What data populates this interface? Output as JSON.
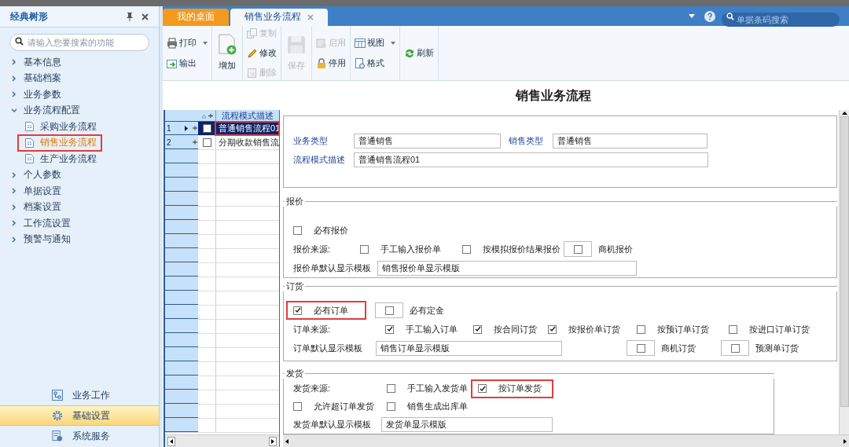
{
  "sidebar": {
    "title": "经典树形",
    "search": {
      "placeholder": "请输入您要搜索的功能"
    },
    "tree": [
      {
        "label": "基本信息",
        "expanded": false
      },
      {
        "label": "基础档案",
        "expanded": false
      },
      {
        "label": "业务参数",
        "expanded": false
      },
      {
        "label": "业务流程配置",
        "expanded": true,
        "children": [
          {
            "label": "采购业务流程",
            "selected": false,
            "highlighted": false
          },
          {
            "label": "销售业务流程",
            "selected": true,
            "highlighted": true
          },
          {
            "label": "生产业务流程",
            "selected": false,
            "highlighted": false
          }
        ]
      },
      {
        "label": "个人参数",
        "expanded": false
      },
      {
        "label": "单据设置",
        "expanded": false
      },
      {
        "label": "档案设置",
        "expanded": false
      },
      {
        "label": "工作流设置",
        "expanded": false
      },
      {
        "label": "预警与通知",
        "expanded": false
      }
    ],
    "nav": [
      {
        "label": "业务工作",
        "selected": false
      },
      {
        "label": "基础设置",
        "selected": true
      },
      {
        "label": "系统服务",
        "selected": false
      }
    ]
  },
  "tabs": [
    {
      "label": "我的桌面",
      "selected": false
    },
    {
      "label": "销售业务流程",
      "selected": true
    }
  ],
  "global_search": {
    "placeholder": "单据条码搜索"
  },
  "toolbar": [
    [
      {
        "label": "打印",
        "dropdown": true,
        "disabled": false,
        "kind": "small"
      },
      {
        "label": "输出",
        "dropdown": false,
        "disabled": false,
        "kind": "small"
      }
    ],
    [
      {
        "label": "增加",
        "dropdown": false,
        "disabled": false,
        "kind": "large"
      }
    ],
    [
      {
        "label": "复制",
        "dropdown": false,
        "disabled": true,
        "kind": "small"
      },
      {
        "label": "修改",
        "dropdown": false,
        "disabled": false,
        "kind": "small"
      },
      {
        "label": "删除",
        "dropdown": false,
        "disabled": true,
        "kind": "small"
      }
    ],
    [
      {
        "label": "保存",
        "dropdown": false,
        "disabled": true,
        "kind": "large"
      }
    ],
    [
      {
        "label": "启用",
        "dropdown": false,
        "disabled": true,
        "kind": "small"
      },
      {
        "label": "停用",
        "dropdown": false,
        "disabled": false,
        "kind": "small"
      }
    ],
    [
      {
        "label": "视图",
        "dropdown": true,
        "disabled": false,
        "kind": "small"
      },
      {
        "label": "格式",
        "dropdown": false,
        "disabled": false,
        "kind": "small"
      }
    ],
    [
      {
        "label": "刷新",
        "dropdown": false,
        "disabled": false,
        "kind": "small"
      }
    ]
  ],
  "page_title": "销售业务流程",
  "grid": {
    "column": "流程模式描述",
    "rows": [
      {
        "number": "1",
        "description": "普通销售流程01",
        "selected": true,
        "checked": false,
        "highlighted": true
      },
      {
        "number": "2",
        "description": "分期收款销售流",
        "selected": false,
        "checked": false,
        "highlighted": false
      }
    ]
  },
  "form": {
    "sections": [
      {
        "rows": [
          [
            {
              "kind": "field-label",
              "text": "业务类型"
            },
            {
              "kind": "field",
              "value": "普通销售"
            },
            {
              "kind": "field-label",
              "text": "销售类型"
            },
            {
              "kind": "field",
              "value": "普通销售"
            }
          ],
          [
            {
              "kind": "field-label",
              "text": "流程模式描述"
            },
            {
              "kind": "field",
              "value": "普通销售流程01"
            }
          ]
        ]
      },
      {
        "title": "报价",
        "rows": [
          [
            {
              "kind": "checkbox",
              "text": "必有报价",
              "checked": false,
              "highlighted": false
            }
          ],
          [
            {
              "kind": "label",
              "text": "报价来源:"
            },
            {
              "kind": "checkbox",
              "text": "手工输入报价单",
              "checked": false,
              "highlighted": false
            },
            {
              "kind": "checkbox",
              "text": "按模拟报价结果报价",
              "checked": false,
              "highlighted": false
            },
            {
              "kind": "boxed-checkbox",
              "text": "商机报价",
              "checked": false,
              "highlighted": false
            }
          ],
          [
            {
              "kind": "label",
              "text": "报价单默认显示模板"
            },
            {
              "kind": "field",
              "value": "销售报价单显示模版"
            }
          ]
        ]
      },
      {
        "title": "订货",
        "rows": [
          [
            {
              "kind": "checkbox",
              "text": "必有订单",
              "checked": true,
              "highlighted": true
            },
            {
              "kind": "boxed-checkbox",
              "text": "必有定金",
              "checked": false,
              "highlighted": false
            }
          ],
          [
            {
              "kind": "label",
              "text": "订单来源:"
            },
            {
              "kind": "checkbox",
              "text": "手工输入订单",
              "checked": true,
              "highlighted": false
            },
            {
              "kind": "checkbox",
              "text": "按合同订货",
              "checked": true,
              "highlighted": false
            },
            {
              "kind": "checkbox",
              "text": "按报价单订货",
              "checked": true,
              "highlighted": false
            },
            {
              "kind": "checkbox",
              "text": "按预订单订货",
              "checked": false,
              "highlighted": false
            },
            {
              "kind": "checkbox",
              "text": "按进口订单订货",
              "checked": false,
              "highlighted": false
            }
          ],
          [
            {
              "kind": "label",
              "text": "订单默认显示模板"
            },
            {
              "kind": "field",
              "value": "销售订单显示模版"
            },
            "",
            "",
            {
              "kind": "boxed-checkbox",
              "text": "商机订货",
              "checked": false,
              "highlighted": false
            },
            {
              "kind": "boxed-checkbox",
              "text": "预测单订货",
              "checked": false,
              "highlighted": false
            }
          ]
        ]
      },
      {
        "title": "发货",
        "rows": [
          [
            {
              "kind": "label",
              "text": "发货来源:"
            },
            {
              "kind": "checkbox",
              "text": "手工输入发货单",
              "checked": false,
              "highlighted": false
            },
            {
              "kind": "checkbox",
              "text": "按订单发货",
              "checked": true,
              "highlighted": true
            }
          ],
          [
            {
              "kind": "checkbox",
              "text": "允许超订单发货",
              "checked": false,
              "highlighted": false
            },
            {
              "kind": "checkbox",
              "text": "销售生成出库单",
              "checked": false,
              "highlighted": false
            }
          ],
          [
            {
              "kind": "label",
              "text": "发货单默认显示模板"
            },
            {
              "kind": "field",
              "value": "发货单显示模版"
            }
          ]
        ]
      }
    ]
  }
}
